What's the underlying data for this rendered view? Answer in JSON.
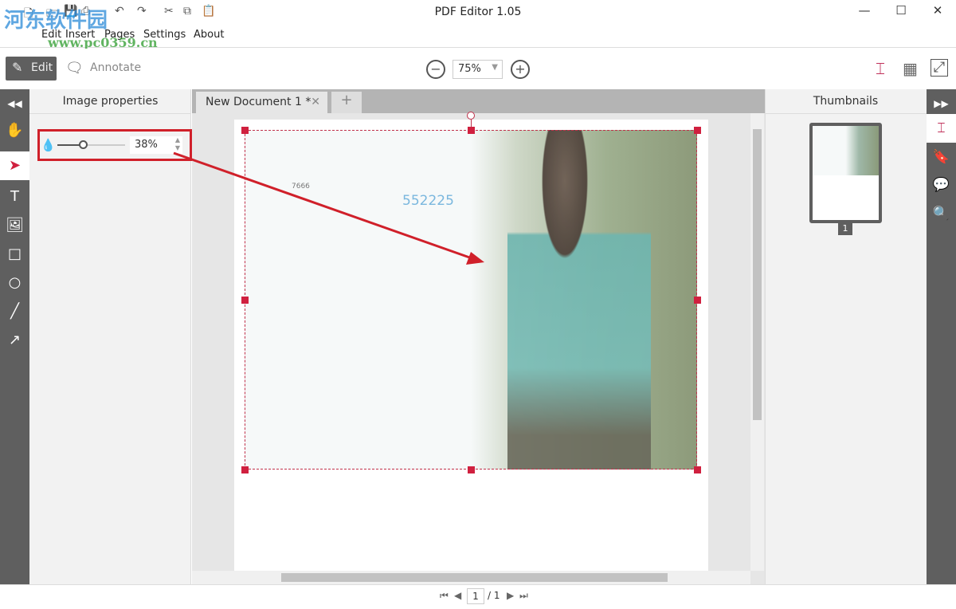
{
  "window": {
    "title": "PDF Editor 1.05",
    "minimize": "—",
    "maximize": "☐",
    "close": "✕"
  },
  "menu": [
    "Edit",
    "Insert",
    "Pages",
    "Settings",
    "About"
  ],
  "watermark": {
    "text": "河东软件园",
    "url": "www.pc0359.cn"
  },
  "toolbar": {
    "edit": "Edit",
    "annotate": "Annotate",
    "zoom": "75%",
    "zoom_out": "−",
    "zoom_in": "+"
  },
  "left_panel": {
    "title": "Image properties",
    "opacity_value": "38%",
    "opacity_fraction": 0.38
  },
  "tabs": [
    {
      "label": "New Document 1 *"
    }
  ],
  "document": {
    "text_small": "7666",
    "text_blue": "552225",
    "accent": "#d0203f",
    "blue": "#7ab7de"
  },
  "right_panel": {
    "title": "Thumbnails",
    "page_label": "1"
  },
  "status": {
    "page": "1",
    "total": "/ 1"
  }
}
